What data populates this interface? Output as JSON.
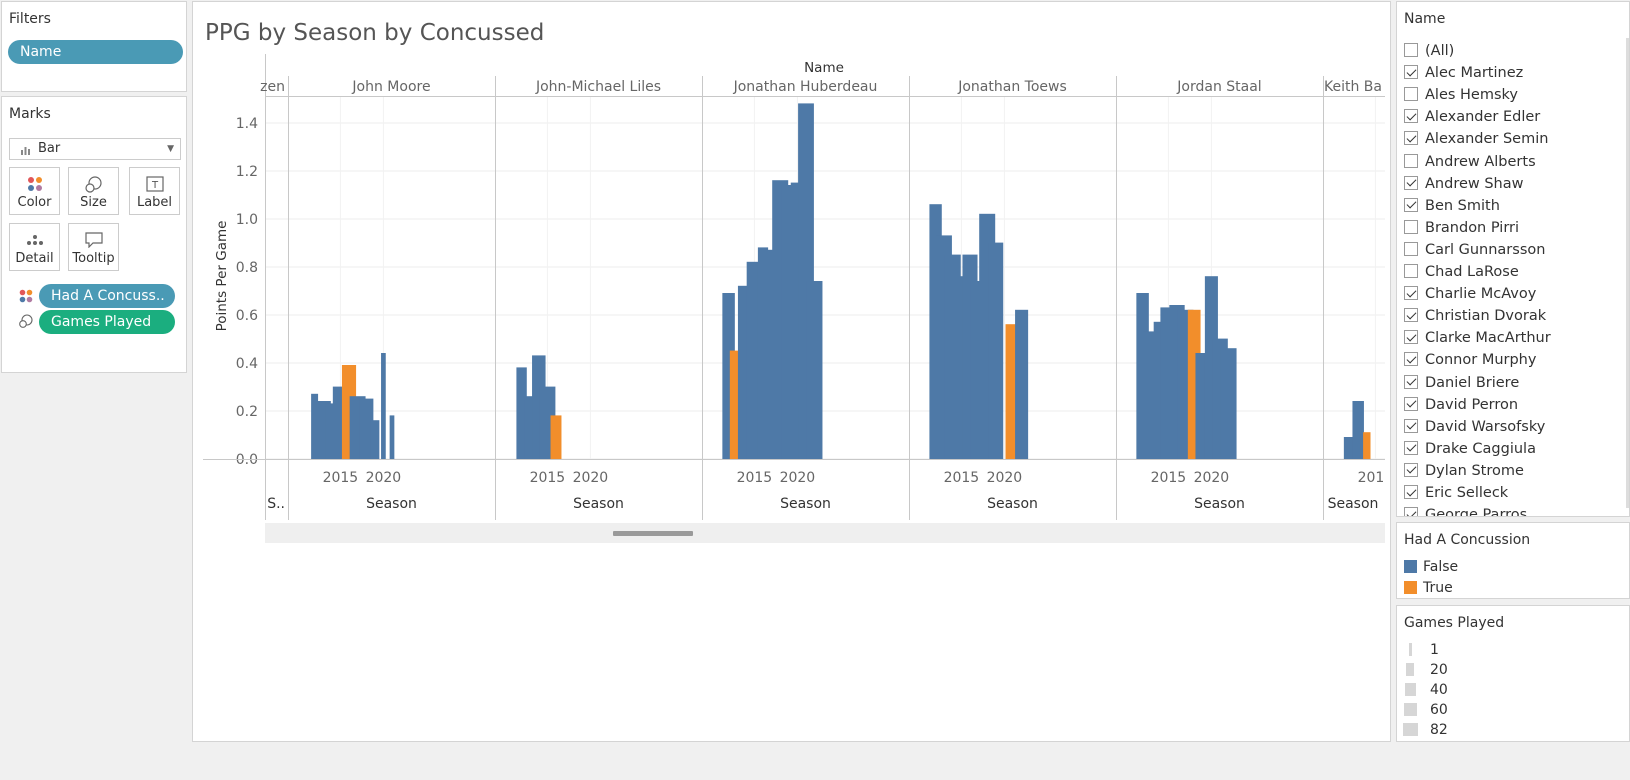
{
  "filters": {
    "title": "Filters",
    "pill": "Name"
  },
  "marks": {
    "title": "Marks",
    "mark_type": "Bar",
    "cards": [
      "Color",
      "Size",
      "Label",
      "Detail",
      "Tooltip"
    ],
    "pills": [
      "Had A Concuss..",
      "Games Played"
    ]
  },
  "name_filter": {
    "title": "Name",
    "items": [
      {
        "label": "(All)",
        "checked": false
      },
      {
        "label": "Alec Martinez",
        "checked": true
      },
      {
        "label": "Ales Hemsky",
        "checked": false
      },
      {
        "label": "Alexander Edler",
        "checked": true
      },
      {
        "label": "Alexander Semin",
        "checked": true
      },
      {
        "label": "Andrew Alberts",
        "checked": false
      },
      {
        "label": "Andrew Shaw",
        "checked": true
      },
      {
        "label": "Ben Smith",
        "checked": true
      },
      {
        "label": "Brandon Pirri",
        "checked": false
      },
      {
        "label": "Carl Gunnarsson",
        "checked": false
      },
      {
        "label": "Chad LaRose",
        "checked": false
      },
      {
        "label": "Charlie McAvoy",
        "checked": true
      },
      {
        "label": "Christian Dvorak",
        "checked": true
      },
      {
        "label": "Clarke MacArthur",
        "checked": true
      },
      {
        "label": "Connor Murphy",
        "checked": true
      },
      {
        "label": "Daniel Briere",
        "checked": true
      },
      {
        "label": "David Perron",
        "checked": true
      },
      {
        "label": "David Warsofsky",
        "checked": true
      },
      {
        "label": "Drake Caggiula",
        "checked": true
      },
      {
        "label": "Dylan Strome",
        "checked": true
      },
      {
        "label": "Eric Selleck",
        "checked": true
      },
      {
        "label": "George Parros",
        "checked": true
      }
    ]
  },
  "color_legend": {
    "title": "Had A Concussion",
    "items": [
      {
        "label": "False",
        "color": "#4e79a7"
      },
      {
        "label": "True",
        "color": "#f28e2b"
      }
    ]
  },
  "size_legend": {
    "title": "Games Played",
    "items": [
      "1",
      "20",
      "40",
      "60",
      "82"
    ]
  },
  "chart_data": {
    "type": "bar",
    "title": "PPG by Season by Concussed",
    "column_header": "Name",
    "xlabel": "Season",
    "ylabel": "Points Per Game",
    "ylim": [
      0,
      1.4
    ],
    "yticks": [
      "0.0",
      "0.2",
      "0.4",
      "0.6",
      "0.8",
      "1.0",
      "1.2",
      "1.4"
    ],
    "xticks": [
      "2015",
      "2020"
    ],
    "colors": {
      "false": "#4e79a7",
      "true": "#f28e2b"
    },
    "panels": [
      {
        "name": "John Moore",
        "bars": [
          {
            "season": 2012,
            "ppg": 0.23,
            "gp": 13,
            "concussed": false
          },
          {
            "season": 2013,
            "ppg": 0.2,
            "gp": 74,
            "concussed": false
          },
          {
            "season": 2014,
            "ppg": 0.19,
            "gp": 57,
            "concussed": false
          },
          {
            "season": 2015,
            "ppg": 0.26,
            "gp": 73,
            "concussed": false
          },
          {
            "season": 2016,
            "ppg": 0.35,
            "gp": 63,
            "concussed": true
          },
          {
            "season": 2017,
            "ppg": 0.22,
            "gp": 81,
            "concussed": false
          },
          {
            "season": 2018,
            "ppg": 0.21,
            "gp": 65,
            "concussed": false
          },
          {
            "season": 2019,
            "ppg": 0.12,
            "gp": 24,
            "concussed": false
          },
          {
            "season": 2020,
            "ppg": 0.4,
            "gp": 5,
            "concussed": false
          },
          {
            "season": 2021,
            "ppg": 0.14,
            "gp": 5,
            "concussed": false
          }
        ]
      },
      {
        "name": "John-Michael Liles",
        "bars": [
          {
            "season": 2012,
            "ppg": 0.34,
            "gp": 32,
            "concussed": false
          },
          {
            "season": 2013,
            "ppg": 0.22,
            "gp": 41,
            "concussed": false
          },
          {
            "season": 2014,
            "ppg": 0.39,
            "gp": 57,
            "concussed": false
          },
          {
            "season": 2015,
            "ppg": 0.26,
            "gp": 82,
            "concussed": false
          },
          {
            "season": 2016,
            "ppg": 0.14,
            "gp": 36,
            "concussed": true
          }
        ]
      },
      {
        "name": "Jonathan Huberdeau",
        "bars": [
          {
            "season": 2012,
            "ppg": 0.65,
            "gp": 48,
            "concussed": false
          },
          {
            "season": 2013,
            "ppg": 0.41,
            "gp": 69,
            "concussed": true
          },
          {
            "season": 2014,
            "ppg": 0.68,
            "gp": 79,
            "concussed": false
          },
          {
            "season": 2015,
            "ppg": 0.78,
            "gp": 76,
            "concussed": false
          },
          {
            "season": 2016,
            "ppg": 0.84,
            "gp": 31,
            "concussed": false
          },
          {
            "season": 2017,
            "ppg": 0.83,
            "gp": 82,
            "concussed": false
          },
          {
            "season": 2018,
            "ppg": 1.12,
            "gp": 82,
            "concussed": false
          },
          {
            "season": 2019,
            "ppg": 1.1,
            "gp": 69,
            "concussed": false
          },
          {
            "season": 2020,
            "ppg": 1.11,
            "gp": 55,
            "concussed": false
          },
          {
            "season": 2021,
            "ppg": 1.44,
            "gp": 80,
            "concussed": false
          },
          {
            "season": 2022,
            "ppg": 0.7,
            "gp": 79,
            "concussed": false
          }
        ]
      },
      {
        "name": "Jonathan Toews",
        "bars": [
          {
            "season": 2012,
            "ppg": 1.02,
            "gp": 47,
            "concussed": false
          },
          {
            "season": 2013,
            "ppg": 0.89,
            "gp": 76,
            "concussed": false
          },
          {
            "season": 2014,
            "ppg": 0.81,
            "gp": 81,
            "concussed": false
          },
          {
            "season": 2015,
            "ppg": 0.72,
            "gp": 80,
            "concussed": false
          },
          {
            "season": 2016,
            "ppg": 0.81,
            "gp": 72,
            "concussed": false
          },
          {
            "season": 2017,
            "ppg": 0.7,
            "gp": 74,
            "concussed": false
          },
          {
            "season": 2018,
            "ppg": 0.98,
            "gp": 82,
            "concussed": false
          },
          {
            "season": 2019,
            "ppg": 0.86,
            "gp": 70,
            "concussed": false
          },
          {
            "season": 2021,
            "ppg": 0.52,
            "gp": 71,
            "concussed": true
          },
          {
            "season": 2022,
            "ppg": 0.58,
            "gp": 53,
            "concussed": false
          }
        ]
      },
      {
        "name": "Jordan Staal",
        "bars": [
          {
            "season": 2012,
            "ppg": 0.65,
            "gp": 48,
            "concussed": false
          },
          {
            "season": 2013,
            "ppg": 0.49,
            "gp": 82,
            "concussed": false
          },
          {
            "season": 2014,
            "ppg": 0.53,
            "gp": 46,
            "concussed": false
          },
          {
            "season": 2015,
            "ppg": 0.59,
            "gp": 82,
            "concussed": false
          },
          {
            "season": 2016,
            "ppg": 0.6,
            "gp": 75,
            "concussed": false
          },
          {
            "season": 2017,
            "ppg": 0.58,
            "gp": 79,
            "concussed": false
          },
          {
            "season": 2018,
            "ppg": 0.58,
            "gp": 50,
            "concussed": true
          },
          {
            "season": 2019,
            "ppg": 0.4,
            "gp": 68,
            "concussed": false
          },
          {
            "season": 2020,
            "ppg": 0.72,
            "gp": 53,
            "concussed": false
          },
          {
            "season": 2021,
            "ppg": 0.46,
            "gp": 78,
            "concussed": false
          },
          {
            "season": 2022,
            "ppg": 0.42,
            "gp": 81,
            "concussed": false
          }
        ]
      },
      {
        "name": "Keith Ba",
        "bars": [
          {
            "season": 2012,
            "ppg": 0.05,
            "gp": 40,
            "concussed": false
          },
          {
            "season": 2013,
            "ppg": 0.2,
            "gp": 40,
            "concussed": false
          },
          {
            "season": 2014,
            "ppg": 0.07,
            "gp": 15,
            "concussed": true
          }
        ]
      }
    ],
    "cut_panel_name": "zen",
    "cut_panel_season_label": "S.."
  }
}
